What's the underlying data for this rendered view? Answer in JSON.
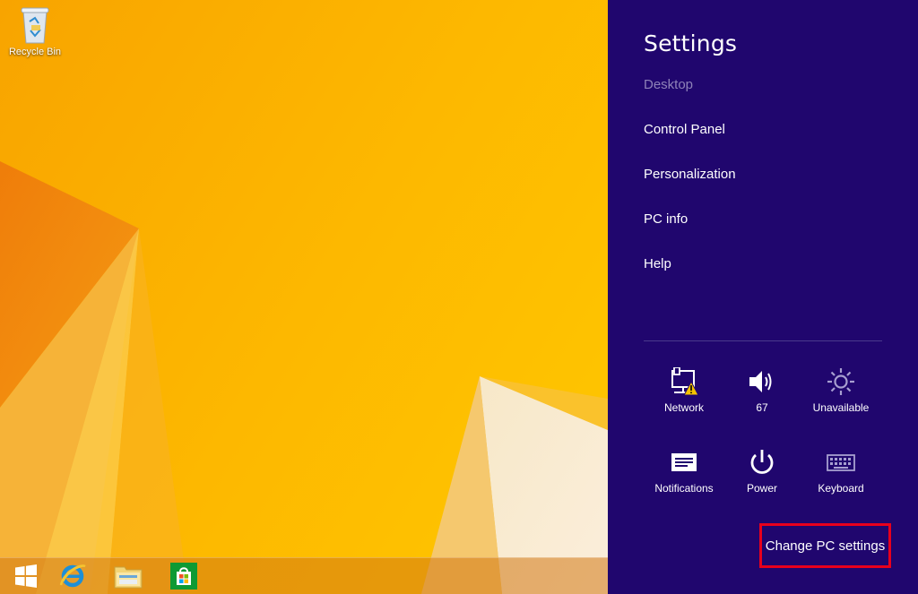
{
  "desktop": {
    "recycle_bin_label": "Recycle Bin"
  },
  "taskbar": {
    "items": [
      "start-icon",
      "internet-explorer-icon",
      "file-explorer-icon",
      "store-icon"
    ]
  },
  "settings_charm": {
    "title": "Settings",
    "context": "Desktop",
    "links": [
      "Control Panel",
      "Personalization",
      "PC info",
      "Help"
    ],
    "quick_settings": {
      "network": "Network",
      "volume": "67",
      "brightness": "Unavailable",
      "notifications": "Notifications",
      "power": "Power",
      "keyboard": "Keyboard"
    },
    "change_pc_settings": "Change PC settings"
  },
  "colors": {
    "charm_background": "#20066e",
    "highlight_border": "#e8001c",
    "wallpaper_orange": "#f7a600"
  }
}
